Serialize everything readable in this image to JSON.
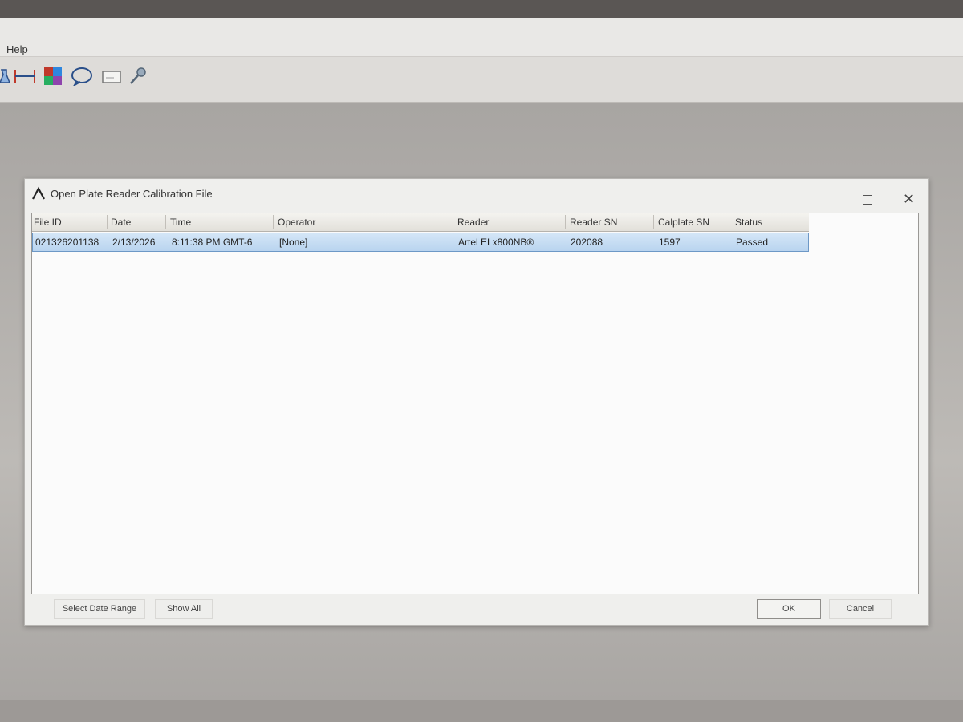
{
  "app": {
    "menu": {
      "help_label": "Help"
    },
    "toolbar": {
      "icons": [
        "flask-icon",
        "measure-icon",
        "color-grid-icon",
        "speech-bubble-icon",
        "rectangle-icon",
        "pin-icon"
      ]
    }
  },
  "dialog": {
    "title": "Open Plate Reader Calibration File",
    "columns": [
      "File ID",
      "Date",
      "Time",
      "Operator",
      "Reader",
      "Reader SN",
      "Calplate SN",
      "Status"
    ],
    "rows": [
      {
        "file_id": "021326201138",
        "date": "2/13/2026",
        "time": "8:11:38 PM GMT-6",
        "operator": "[None]",
        "reader": "Artel ELx800NB®",
        "reader_sn": "202088",
        "calplate_sn": "1597",
        "status": "Passed"
      }
    ],
    "buttons": {
      "select_date_range": "Select Date Range",
      "show_all": "Show All",
      "ok": "OK",
      "cancel": "Cancel"
    }
  },
  "colors": {
    "selection": "#b9d4ef",
    "selection_border": "#6d98c6",
    "dialog_bg": "#efefed"
  }
}
